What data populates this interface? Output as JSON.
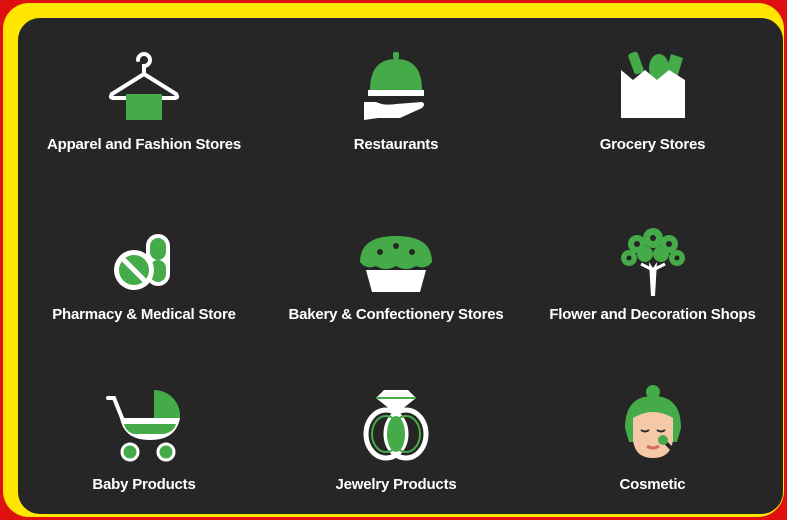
{
  "categories": [
    {
      "label": "Apparel and Fashion Stores",
      "icon": "hanger-icon"
    },
    {
      "label": "Restaurants",
      "icon": "food-tray-icon"
    },
    {
      "label": "Grocery Stores",
      "icon": "grocery-bag-icon"
    },
    {
      "label": "Pharmacy & Medical Store",
      "icon": "pills-icon"
    },
    {
      "label": "Bakery & Confectionery Stores",
      "icon": "pie-icon"
    },
    {
      "label": "Flower and Decoration Shops",
      "icon": "flower-bouquet-icon"
    },
    {
      "label": "Baby Products",
      "icon": "baby-stroller-icon"
    },
    {
      "label": "Jewelry Products",
      "icon": "rings-icon"
    },
    {
      "label": "Cosmetic",
      "icon": "cosmetic-face-icon"
    }
  ],
  "colors": {
    "accent": "#45ab48",
    "panel": "#262626",
    "frame": "#ffe600",
    "border": "#e01010",
    "text": "#ffffff"
  }
}
